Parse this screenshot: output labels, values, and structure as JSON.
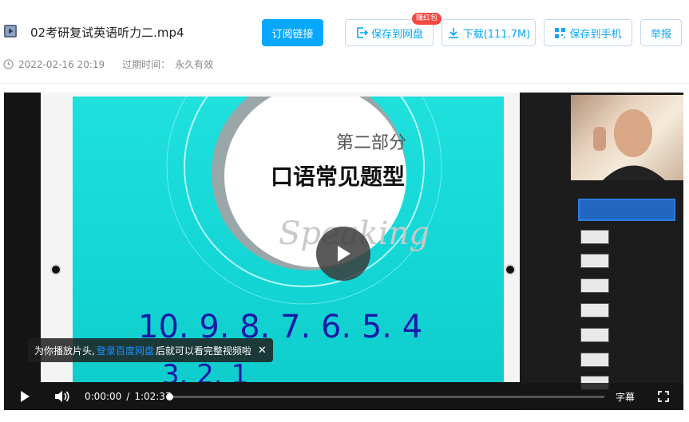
{
  "header": {
    "file_icon": "video-file-icon",
    "title": "02考研复试英语听力二.mp4",
    "subscribe_label": "订阅链接",
    "save_to_pan_label": "保存到网盘",
    "badge": "赚红包",
    "download_label": "下载(111.7M)",
    "save_to_phone_label": "保存到手机",
    "report_label": "举报",
    "date": "2022-02-16 20:19",
    "expire_label": "过期时间：",
    "expire_value": "永久有效"
  },
  "slide": {
    "part": "第二部分",
    "heading": "口语常见题型",
    "script_word": "Speaking",
    "row1": "10. 9. 8. 7. 6. 5. 4",
    "row2": "3. 2. 1"
  },
  "player": {
    "toast_prefix": "为你播放片头,",
    "toast_link": "登录百度网盘",
    "toast_suffix": "后就可以看完整视频啦",
    "current_time": "0:00:00",
    "separator": "/",
    "duration": "1:02:37",
    "progress": 0,
    "subtitles_label": "字幕"
  },
  "colors": {
    "accent": "#06a7ff",
    "badge": "#f5463f",
    "slide_bg": "#14d7d6",
    "ink": "#1a1aa8"
  }
}
